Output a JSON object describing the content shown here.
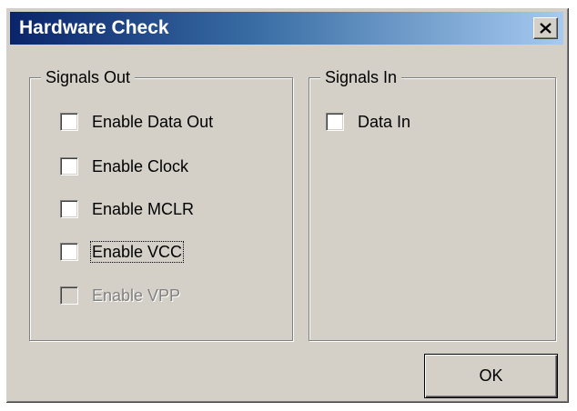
{
  "window": {
    "title": "Hardware Check",
    "close_icon": "close-icon",
    "titlebar_colors": [
      "#0a246a",
      "#a6caf0"
    ]
  },
  "signals_out": {
    "legend": "Signals Out",
    "items": [
      {
        "label": "Enable Data Out",
        "checked": false,
        "enabled": true,
        "focused": false
      },
      {
        "label": "Enable Clock",
        "checked": false,
        "enabled": true,
        "focused": false
      },
      {
        "label": "Enable MCLR",
        "checked": false,
        "enabled": true,
        "focused": false
      },
      {
        "label": "Enable VCC",
        "checked": false,
        "enabled": true,
        "focused": true
      },
      {
        "label": "Enable VPP",
        "checked": false,
        "enabled": false,
        "focused": false
      }
    ]
  },
  "signals_in": {
    "legend": "Signals In",
    "items": [
      {
        "label": "Data In",
        "checked": false,
        "enabled": true,
        "focused": false
      }
    ]
  },
  "buttons": {
    "ok": "OK"
  }
}
